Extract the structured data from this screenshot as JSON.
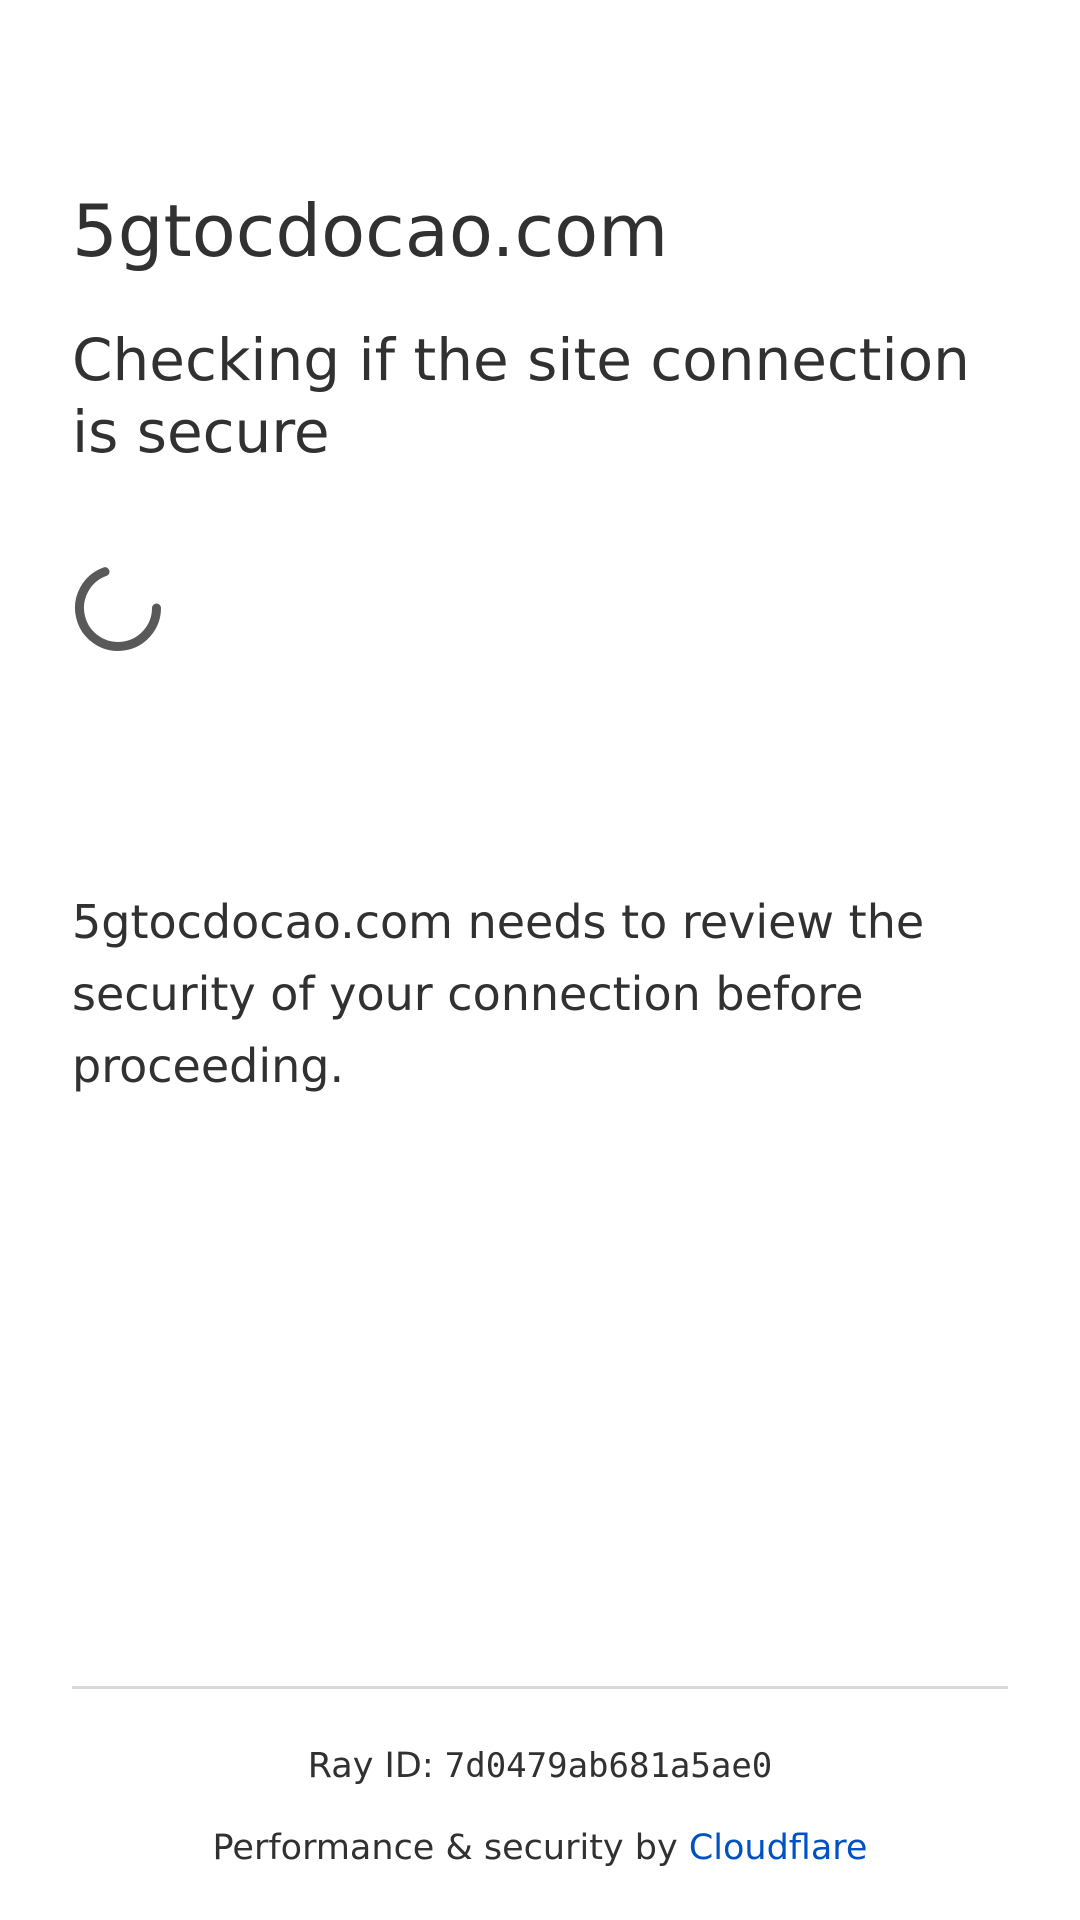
{
  "page": {
    "site_name": "5gtocdocao.com",
    "heading": "Checking if the site connection is secure",
    "message": "5gtocdocao.com needs to review the security of your connection before proceeding.",
    "spinner_icon": "loading-spinner-icon"
  },
  "footer": {
    "ray_label": "Ray ID: ",
    "ray_id": "7d0479ab681a5ae0",
    "performance_label": "Performance & security by ",
    "provider_link": "Cloudflare"
  },
  "colors": {
    "text": "#313131",
    "spinner": "#595959",
    "link": "#0051c3",
    "divider": "#d9d9d9",
    "background": "#ffffff"
  }
}
